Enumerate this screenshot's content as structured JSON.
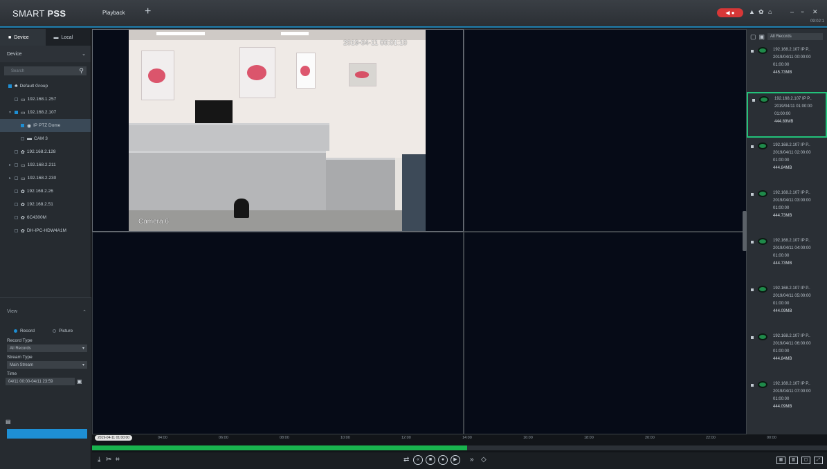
{
  "app": {
    "title": "SMART",
    "title_bold": "PSS",
    "tab": "Playback",
    "add_tab": "+"
  },
  "titlebar": {
    "clock": "09:02:1"
  },
  "left_panel": {
    "tabs": [
      {
        "label": "Device",
        "icon": "camera-icon"
      },
      {
        "label": "Local",
        "icon": "monitor-icon"
      }
    ],
    "section": "Device",
    "search_placeholder": "Search",
    "tree": [
      {
        "label": "Default Group",
        "icon": "group-icon",
        "checked": true,
        "indent": 0,
        "arrow": ""
      },
      {
        "label": "192.168.1.257",
        "icon": "nvr-icon",
        "checked": false,
        "indent": 1,
        "arrow": ""
      },
      {
        "label": "192.168.2.107",
        "icon": "nvr-icon",
        "checked": true,
        "indent": 1,
        "arrow": "▾"
      },
      {
        "label": "IP PTZ Dome",
        "icon": "ptz-icon",
        "checked": true,
        "indent": 2,
        "arrow": "",
        "selected": true
      },
      {
        "label": "CAM 3",
        "icon": "camera-icon",
        "checked": false,
        "indent": 2,
        "arrow": ""
      },
      {
        "label": "192.168.2.128",
        "icon": "ipc-icon",
        "checked": false,
        "indent": 1,
        "arrow": ""
      },
      {
        "label": "192.168.2.211",
        "icon": "nvr-icon",
        "checked": false,
        "indent": 1,
        "arrow": "▸"
      },
      {
        "label": "192.168.2.230",
        "icon": "nvr-icon",
        "checked": false,
        "indent": 1,
        "arrow": "▸"
      },
      {
        "label": "192.168.2.26",
        "icon": "ipc-icon",
        "checked": false,
        "indent": 1,
        "arrow": ""
      },
      {
        "label": "192.168.2.51",
        "icon": "ipc-icon",
        "checked": false,
        "indent": 1,
        "arrow": ""
      },
      {
        "label": "6C4300M",
        "icon": "ipc-icon",
        "checked": false,
        "indent": 1,
        "arrow": ""
      },
      {
        "label": "DH-IPC-HDW4A1M",
        "icon": "ipc-icon",
        "checked": false,
        "indent": 1,
        "arrow": ""
      }
    ],
    "view": {
      "title": "View",
      "radio_record": "Record",
      "radio_picture": "Picture",
      "record_type_label": "Record Type",
      "record_type_value": "All Records",
      "stream_type_label": "Stream Type",
      "stream_type_value": "Main Stream",
      "time_label": "Time",
      "time_value": "04/11 00:00-04/11 23:59"
    }
  },
  "video": {
    "osd_time": "2019-04-11 00:01:10",
    "osd_camera": "Camera 6"
  },
  "timeline": {
    "cursor": "2019-04-11 01:00:00",
    "ticks": [
      "04:00",
      "06:00",
      "08:00",
      "10:00",
      "12:00",
      "14:00",
      "16:00",
      "18:00",
      "20:00",
      "22:00",
      "00:00"
    ],
    "recorded_fraction": 0.51
  },
  "right_panel": {
    "filter": "All Records",
    "records": [
      {
        "line1": "192.168.2.107 IP P..",
        "line2": "2019/04/11 00:00:00",
        "line3": "01:00:00",
        "size": "445.73MB",
        "selected": false
      },
      {
        "line1": "192.168.2.107 IP P..",
        "line2": "2019/04/11 01:00:00",
        "line3": "01:00:00",
        "size": "444.89MB",
        "selected": true
      },
      {
        "line1": "192.168.2.107 IP P..",
        "line2": "2019/04/11 02:00:00",
        "line3": "01:00:00",
        "size": "444.84MB",
        "selected": false
      },
      {
        "line1": "192.168.2.107 IP P..",
        "line2": "2019/04/11 03:00:00",
        "line3": "01:00:00",
        "size": "444.73MB",
        "selected": false
      },
      {
        "line1": "192.168.2.107 IP P..",
        "line2": "2019/04/11 04:00:00",
        "line3": "01:00:00",
        "size": "444.73MB",
        "selected": false
      },
      {
        "line1": "192.168.2.107 IP P..",
        "line2": "2019/04/11 05:00:00",
        "line3": "01:00:00",
        "size": "444.09MB",
        "selected": false
      },
      {
        "line1": "192.168.2.107 IP P..",
        "line2": "2019/04/11 06:00:00",
        "line3": "01:00:00",
        "size": "444.84MB",
        "selected": false
      },
      {
        "line1": "192.168.2.107 IP P..",
        "line2": "2019/04/11 07:00:00",
        "line3": "01:00:00",
        "size": "444.09MB",
        "selected": false
      }
    ]
  },
  "colors": {
    "accent": "#1e8fd4",
    "record_green": "#19b34e",
    "selected_border": "#22c27a",
    "alarm": "#d73737"
  }
}
